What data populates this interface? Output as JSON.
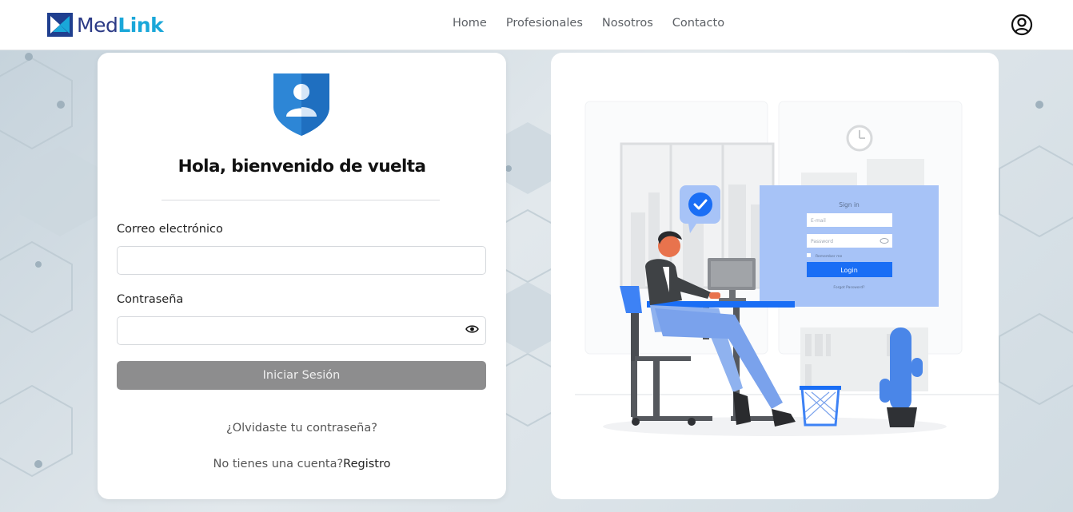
{
  "brand": {
    "name_part1": "Med",
    "name_part2": "Link"
  },
  "nav": [
    "Home",
    "Profesionales",
    "Nosotros",
    "Contacto"
  ],
  "login": {
    "title": "Hola, bienvenido de vuelta",
    "email_label": "Correo electrónico",
    "email_value": "",
    "password_label": "Contraseña",
    "password_value": "",
    "submit_label": "Iniciar Sesión",
    "forgot_link": "¿Olvidaste tu contraseña?",
    "no_account_text": "No tienes una cuenta?",
    "register_link": "Registro"
  },
  "illustration": {
    "signin_title": "Sign in",
    "email_placeholder": "E-mail",
    "password_placeholder": "Password",
    "remember_label": "Remember me",
    "login_button": "Login",
    "forgot_text": "Forgot Password?"
  },
  "colors": {
    "brand_dark": "#2b3a86",
    "brand_light": "#1aa7d9",
    "shield_blue": "#2d86d6",
    "button_gray": "#8d8d8e",
    "illus_blue": "#3d82f5"
  }
}
